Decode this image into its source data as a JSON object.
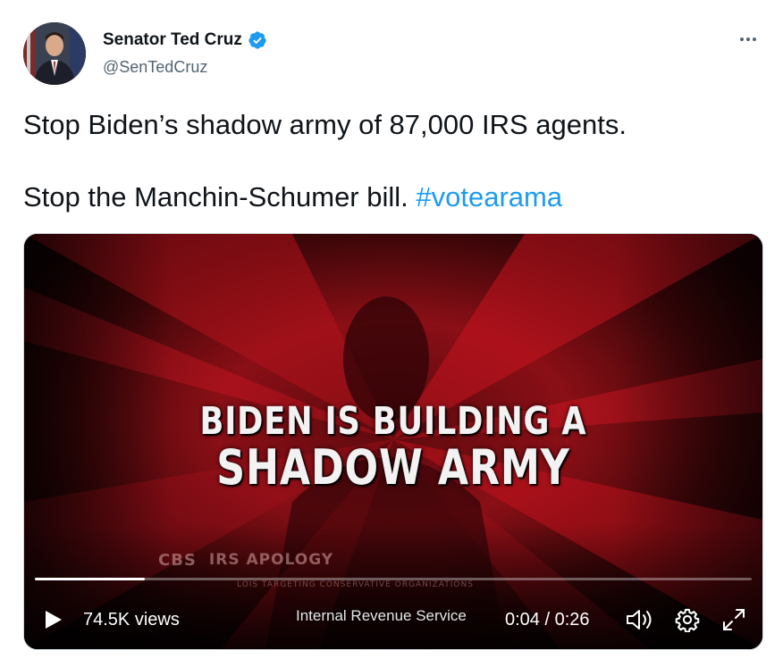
{
  "author": {
    "display_name": "Senator Ted Cruz",
    "handle": "@SenTedCruz",
    "verified": true,
    "verified_color": "#1d9bf0"
  },
  "tweet": {
    "line1": "Stop Biden’s shadow army of 87,000 IRS agents.",
    "line2_text": "Stop the Manchin-Schumer bill. ",
    "hashtag": "#votearama",
    "hashtag_color": "#1d9bf0"
  },
  "video": {
    "headline_line1": "BIDEN IS BUILDING A",
    "headline_line2": "SHADOW ARMY",
    "chyron_network": "CBS",
    "chyron_topic": "IRS APOLOGY",
    "chyron_sub": "LOIS TARGETING CONSERVATIVE ORGANIZATIONS",
    "views": "74.5K views",
    "caption": "Internal Revenue Service",
    "time": "0:04 / 0:26",
    "progress_fraction": 0.1538
  },
  "icons": {
    "more": "more-horizontal-icon",
    "play": "play-icon",
    "volume": "volume-icon",
    "settings": "gear-icon",
    "fullscreen": "fullscreen-icon"
  }
}
